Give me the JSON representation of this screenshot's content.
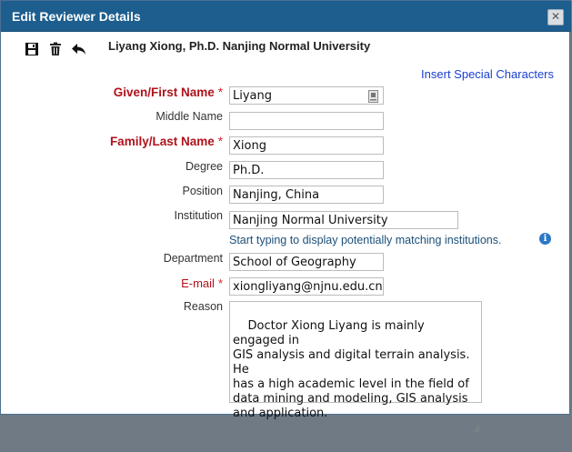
{
  "dialog": {
    "title": "Edit Reviewer Details",
    "close_glyph": "✕"
  },
  "toolbar": {
    "icons": [
      "save-icon",
      "trash-icon",
      "undo-arrow-icon"
    ]
  },
  "heading": "Liyang Xiong, Ph.D. Nanjing Normal University",
  "special_chars_link": "Insert Special Characters",
  "form": {
    "given_name": {
      "label": "Given/First Name",
      "required": "*",
      "value": "Liyang"
    },
    "middle_name": {
      "label": "Middle Name",
      "value": ""
    },
    "family_name": {
      "label": "Family/Last Name",
      "required": "*",
      "value": "Xiong"
    },
    "degree": {
      "label": "Degree",
      "value": "Ph.D."
    },
    "position": {
      "label": "Position",
      "value": "Nanjing, China"
    },
    "institution": {
      "label": "Institution",
      "value": "Nanjing Normal University",
      "hint": "Start typing to display potentially matching institutions."
    },
    "department": {
      "label": "Department",
      "value": "School of Geography"
    },
    "email": {
      "label": "E-mail",
      "required": "*",
      "value": "xiongliyang@njnu.edu.cn"
    },
    "reason": {
      "label": "Reason",
      "value": "Doctor Xiong Liyang is mainly engaged in\nGIS analysis and digital terrain analysis. He\nhas a high academic level in the field of\ndata mining and modeling, GIS analysis\nand application."
    }
  },
  "colors": {
    "titlebar": "#1d5e8f",
    "required_label": "#b0121b",
    "link": "#1a3fcf",
    "hint": "#1b4f78",
    "info_icon": "#2a78c8"
  }
}
